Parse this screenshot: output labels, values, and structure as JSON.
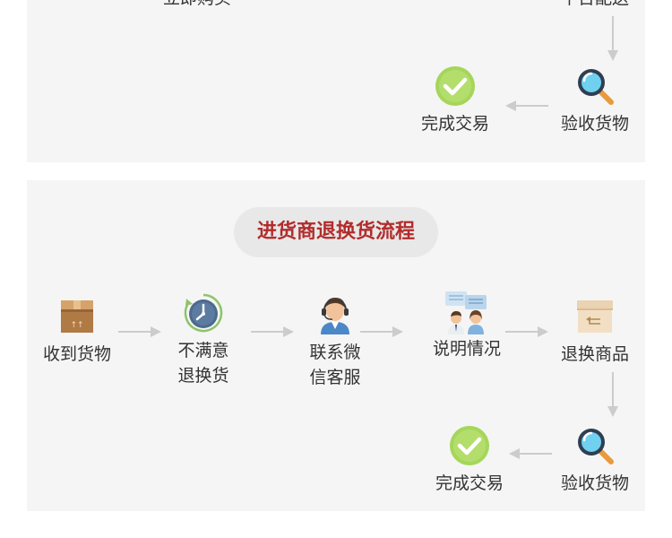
{
  "purchase_flow": {
    "steps": {
      "buy_now": "立即购买",
      "platform_delivery": "平台配送",
      "inspect_goods": "验收货物",
      "complete_trade": "完成交易"
    }
  },
  "return_flow": {
    "title": "进货商退换货流程",
    "steps": {
      "receive_goods": "收到货物",
      "unsatisfied": "不满意退换货",
      "contact_service": "联系微信客服",
      "explain_situation": "说明情况",
      "return_exchange": "退换商品",
      "inspect_goods": "验收货物",
      "complete_trade": "完成交易"
    }
  },
  "colors": {
    "panel_bg": "#f5f5f5",
    "title_text": "#b22c2c",
    "pill_bg": "#e8e8e8",
    "arrow": "#cccccc",
    "check_green": "#a5d65a"
  },
  "icons": {
    "box": "package-box-icon",
    "clock": "refresh-clock-icon",
    "agent": "customer-service-agent-icon",
    "chat": "chat-conversation-icon",
    "return_box": "return-box-icon",
    "magnifier": "magnifier-icon",
    "check": "check-circle-icon"
  }
}
